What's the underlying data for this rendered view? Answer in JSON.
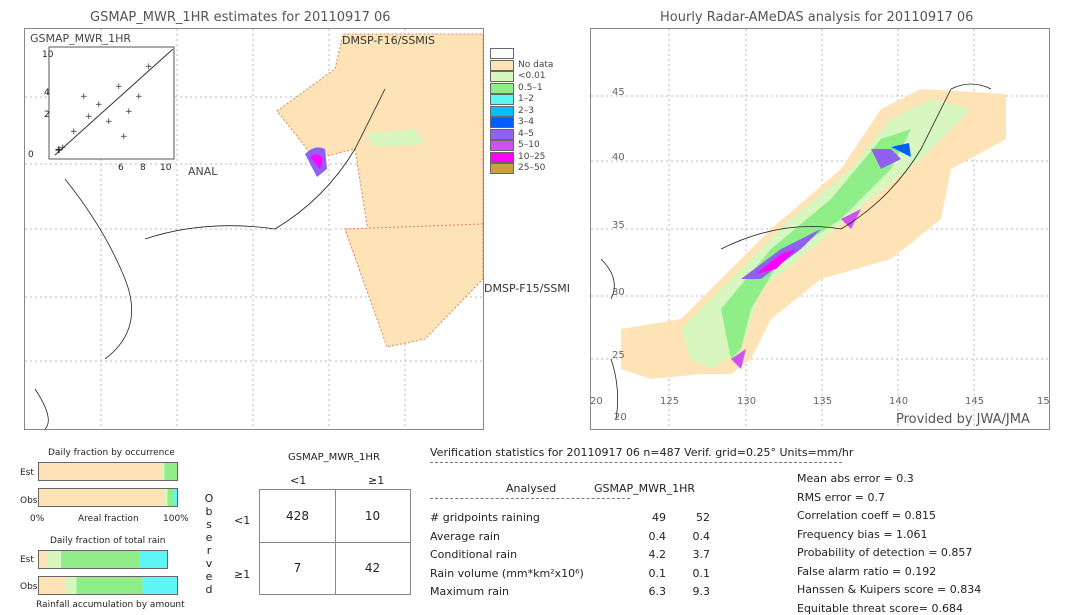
{
  "left_title": "GSMAP_MWR_1HR estimates for 20110917 06",
  "right_title": "Hourly Radar-AMeDAS analysis for 20110917 06",
  "left_map": {
    "sensor_labels": [
      "DMSP-F16/SSMIS",
      "DMSP-F15/SSMI"
    ],
    "inset": {
      "ylabel": "GSMAP_MWR_1HR",
      "xlabel": "ANAL",
      "ticks": [
        "0",
        "2",
        "4",
        "6",
        "8",
        "10"
      ]
    }
  },
  "right_map": {
    "lon_ticks": [
      "125",
      "130",
      "135",
      "140",
      "145",
      "15"
    ],
    "lat_ticks": [
      "45",
      "40",
      "35",
      "30",
      "25",
      "20"
    ],
    "credit": "Provided by JWA/JMA"
  },
  "legend": [
    {
      "label": "",
      "color": "#ffffff"
    },
    {
      "label": "No data",
      "color": "#fde3b5"
    },
    {
      "label": "<0.01",
      "color": "#d8f7c0"
    },
    {
      "label": "0.5–1",
      "color": "#90ee88"
    },
    {
      "label": "1–2",
      "color": "#5ef5f5"
    },
    {
      "label": "2–3",
      "color": "#00bfff"
    },
    {
      "label": "3–4",
      "color": "#0060ff"
    },
    {
      "label": "4–5",
      "color": "#9060f0"
    },
    {
      "label": "5–10",
      "color": "#d050f0"
    },
    {
      "label": "10–25",
      "color": "#ff00ff"
    },
    {
      "label": "25–50",
      "color": "#c8a040"
    }
  ],
  "occurrence": {
    "title": "Daily fraction by occurrence",
    "est": "Est",
    "obs": "Obs",
    "x0": "0%",
    "xmid": "Areal fraction",
    "x1": "100%"
  },
  "total_rain": {
    "title": "Daily fraction of total rain",
    "est": "Est",
    "obs": "Obs",
    "footer": "Rainfall accumulation by amount"
  },
  "contingency": {
    "title": "GSMAP_MWR_1HR",
    "col_labels": [
      "<1",
      "≥1"
    ],
    "row_labels": [
      "<1",
      "≥1"
    ],
    "side_label": "Observed",
    "values": [
      [
        428,
        10
      ],
      [
        7,
        42
      ]
    ]
  },
  "stats": {
    "header": "Verification statistics for 20110917 06   n=487   Verif. grid=0.25°   Units=mm/hr",
    "col1": "Analysed",
    "col2": "GSMAP_MWR_1HR",
    "rows": [
      {
        "label": "# gridpoints raining",
        "a": "49",
        "b": "52"
      },
      {
        "label": "Average rain",
        "a": "0.4",
        "b": "0.4"
      },
      {
        "label": "Conditional rain",
        "a": "4.2",
        "b": "3.7"
      },
      {
        "label": "Rain volume (mm*km²x10⁶)",
        "a": "0.1",
        "b": "0.1"
      },
      {
        "label": "Maximum rain",
        "a": "6.3",
        "b": "9.3"
      }
    ],
    "scores": [
      "Mean abs error = 0.3",
      "RMS error = 0.7",
      "Correlation coeff = 0.815",
      "Frequency bias = 1.061",
      "Probability of detection = 0.857",
      "False alarm ratio = 0.192",
      "Hanssen & Kuipers score = 0.834",
      "Equitable threat score= 0.684"
    ]
  },
  "chart_data": {
    "type": "table",
    "contingency": [
      [
        428,
        10
      ],
      [
        7,
        42
      ]
    ],
    "n": 487
  }
}
